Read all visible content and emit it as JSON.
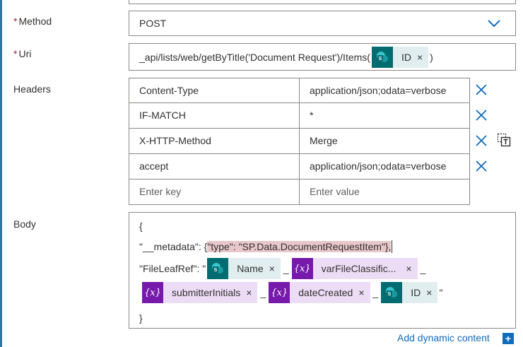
{
  "colors": {
    "accent": "#0f6cbd",
    "sharepoint": "#036c70",
    "variable": "#7719aa",
    "required": "#a4262c"
  },
  "method": {
    "required_mark": "*",
    "label": "Method",
    "value": "POST",
    "icon": "chevron-down-icon"
  },
  "uri": {
    "required_mark": "*",
    "label": "Uri",
    "prefix": "_api/lists/web/getByTitle('Document Request')/Items(",
    "token_label": "ID",
    "token_remove": "×",
    "suffix": ")"
  },
  "headers": {
    "label": "Headers",
    "rows": [
      {
        "key": "Content-Type",
        "value": "application/json;odata=verbose"
      },
      {
        "key": "IF-MATCH",
        "value": "*"
      },
      {
        "key": "X-HTTP-Method",
        "value": "Merge"
      },
      {
        "key": "accept",
        "value": "application/json;odata=verbose"
      }
    ],
    "key_placeholder": "Enter key",
    "value_placeholder": "Enter value",
    "remove_icon": "close-icon",
    "copy_icon": "text-copy-icon"
  },
  "body": {
    "label": "Body",
    "line1": "{",
    "line2_prefix": "\"__metadata\": {",
    "line2_highlight": "\"type\": \"SP.Data.DocumentRequestItem\"},",
    "line3_prefix": "\"FileLeafRef\": \"",
    "line3_tokens": [
      {
        "kind": "sharepoint",
        "label": "Name"
      },
      {
        "kind": "variable",
        "label": "varFileClassific..."
      }
    ],
    "line4_tokens": [
      {
        "kind": "variable",
        "label": "submitterInitials"
      },
      {
        "kind": "variable",
        "label": "dateCreated"
      },
      {
        "kind": "sharepoint",
        "label": "ID"
      }
    ],
    "separator": "_",
    "token_remove": "×",
    "var_glyph": "{x}",
    "line4_suffix": "\"",
    "line5": "}"
  },
  "footer": {
    "add_dynamic": "Add dynamic content",
    "plus": "+"
  }
}
